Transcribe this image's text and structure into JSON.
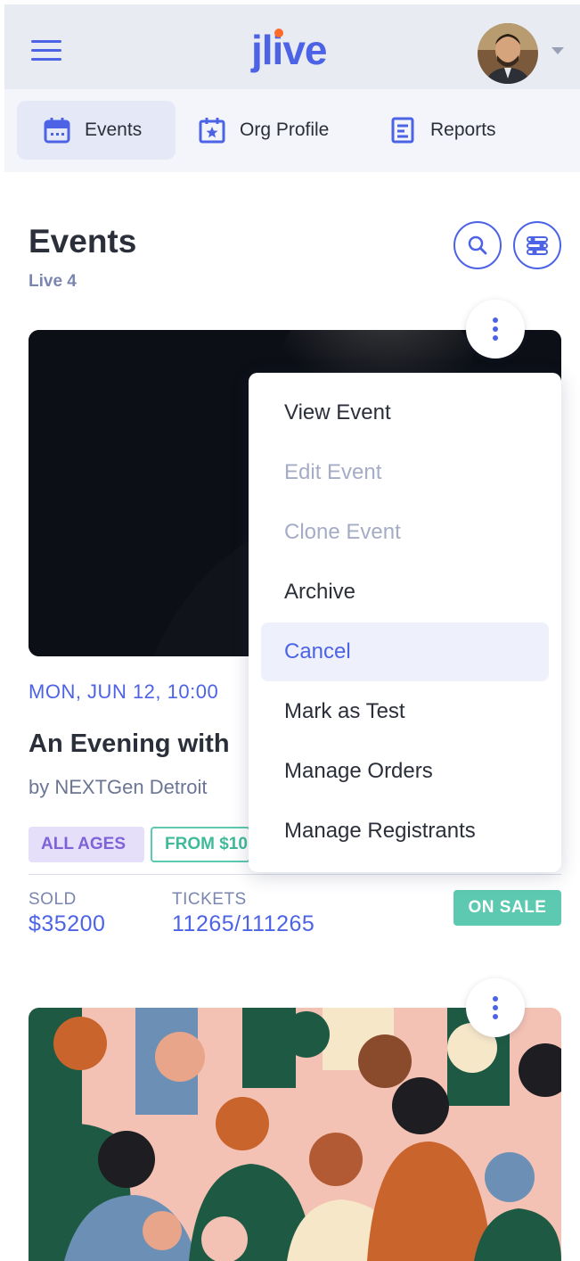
{
  "header": {
    "logo_text": "jlive",
    "user_avatar": "profile-photo"
  },
  "tabs": [
    {
      "label": "Events",
      "icon": "calendar-icon",
      "active": true
    },
    {
      "label": "Org Profile",
      "icon": "calendar-star-icon",
      "active": false
    },
    {
      "label": "Reports",
      "icon": "report-icon",
      "active": false
    }
  ],
  "page": {
    "title": "Events",
    "live_count": "Live 4"
  },
  "events": [
    {
      "date": "MON, JUN 12, 10:00",
      "title": "An Evening with",
      "organizer": "by NEXTGen Detroit",
      "badges": [
        "ALL AGES",
        "FROM $10"
      ],
      "sold_label": "SOLD",
      "sold_value": "$35200",
      "tickets_label": "TICKETS",
      "tickets_value": "11265/111265",
      "status": "ON SALE"
    }
  ],
  "context_menu": {
    "items": [
      {
        "label": "View Event",
        "state": "normal"
      },
      {
        "label": "Edit Event",
        "state": "disabled"
      },
      {
        "label": "Clone Event",
        "state": "disabled"
      },
      {
        "label": "Archive",
        "state": "normal"
      },
      {
        "label": "Cancel",
        "state": "hover"
      },
      {
        "label": "Mark as Test",
        "state": "normal"
      },
      {
        "label": "Manage Orders",
        "state": "normal"
      },
      {
        "label": "Manage Registrants",
        "state": "normal"
      }
    ]
  },
  "colors": {
    "accent": "#4d63e6",
    "logo_dot": "#ff6b2c",
    "on_sale": "#5cc9b0",
    "all_ages_bg": "#e6dffa"
  }
}
